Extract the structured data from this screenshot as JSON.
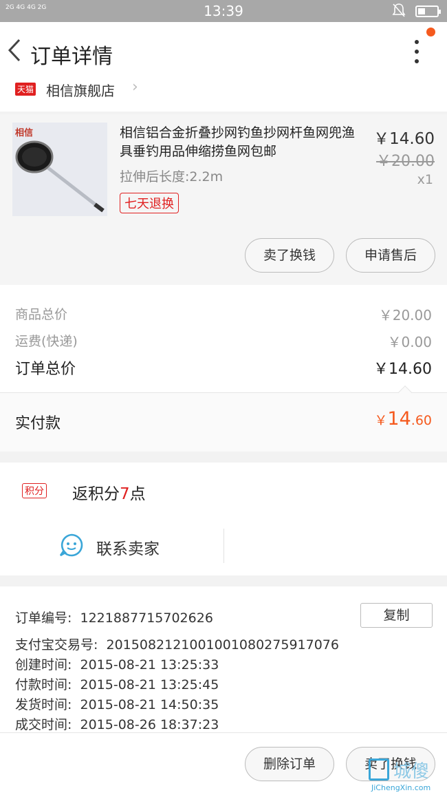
{
  "status_bar": {
    "signal_text": "2G 4G 4G 2G",
    "time": "13:39"
  },
  "header": {
    "title": "订单详情"
  },
  "shop": {
    "badge": "天猫",
    "name": "相信旗舰店"
  },
  "product": {
    "thumb_logo": "相信",
    "title": "相信铝合金折叠抄网钓鱼抄网杆鱼网兜渔具垂钓用品伸缩捞鱼网包邮",
    "spec": "拉伸后长度:2.2m",
    "tag": "七天退换",
    "price": "￥14.60",
    "original_price": "￥20.00",
    "quantity": "x1",
    "btn_resell": "卖了换钱",
    "btn_aftersale": "申请售后"
  },
  "summary": {
    "goods_total_label": "商品总价",
    "goods_total_value": "￥20.00",
    "shipping_label": "运费(快递)",
    "shipping_value": "￥0.00",
    "order_total_label": "订单总价",
    "order_total_value": "￥14.60"
  },
  "paid": {
    "label": "实付款",
    "currency": "￥",
    "integer": "14",
    "decimal": ".60"
  },
  "points": {
    "badge": "积分",
    "prefix": "返积分",
    "count": "7",
    "suffix": "点"
  },
  "contact": {
    "label": "联系卖家"
  },
  "order_info": {
    "order_no_label": "订单编号:",
    "order_no": "1221887715702626",
    "copy_label": "复制",
    "alipay_label": "支付宝交易号:",
    "alipay_no": "2015082121001001080275917076",
    "created_label": "创建时间:",
    "created": "2015-08-21 13:25:33",
    "paid_label": "付款时间:",
    "paid": "2015-08-21 13:25:45",
    "shipped_label": "发货时间:",
    "shipped": "2015-08-21 14:50:35",
    "done_label": "成交时间:",
    "done": "2015-08-26 18:37:23"
  },
  "footer": {
    "delete_label": "删除订单",
    "resell_label": "卖了换钱"
  },
  "watermark": {
    "text": "城傻",
    "url": "JiChengXin.com"
  },
  "colors": {
    "accent": "#f55a1e",
    "tmall_red": "#e02020",
    "contact_blue": "#3aa6d8"
  }
}
